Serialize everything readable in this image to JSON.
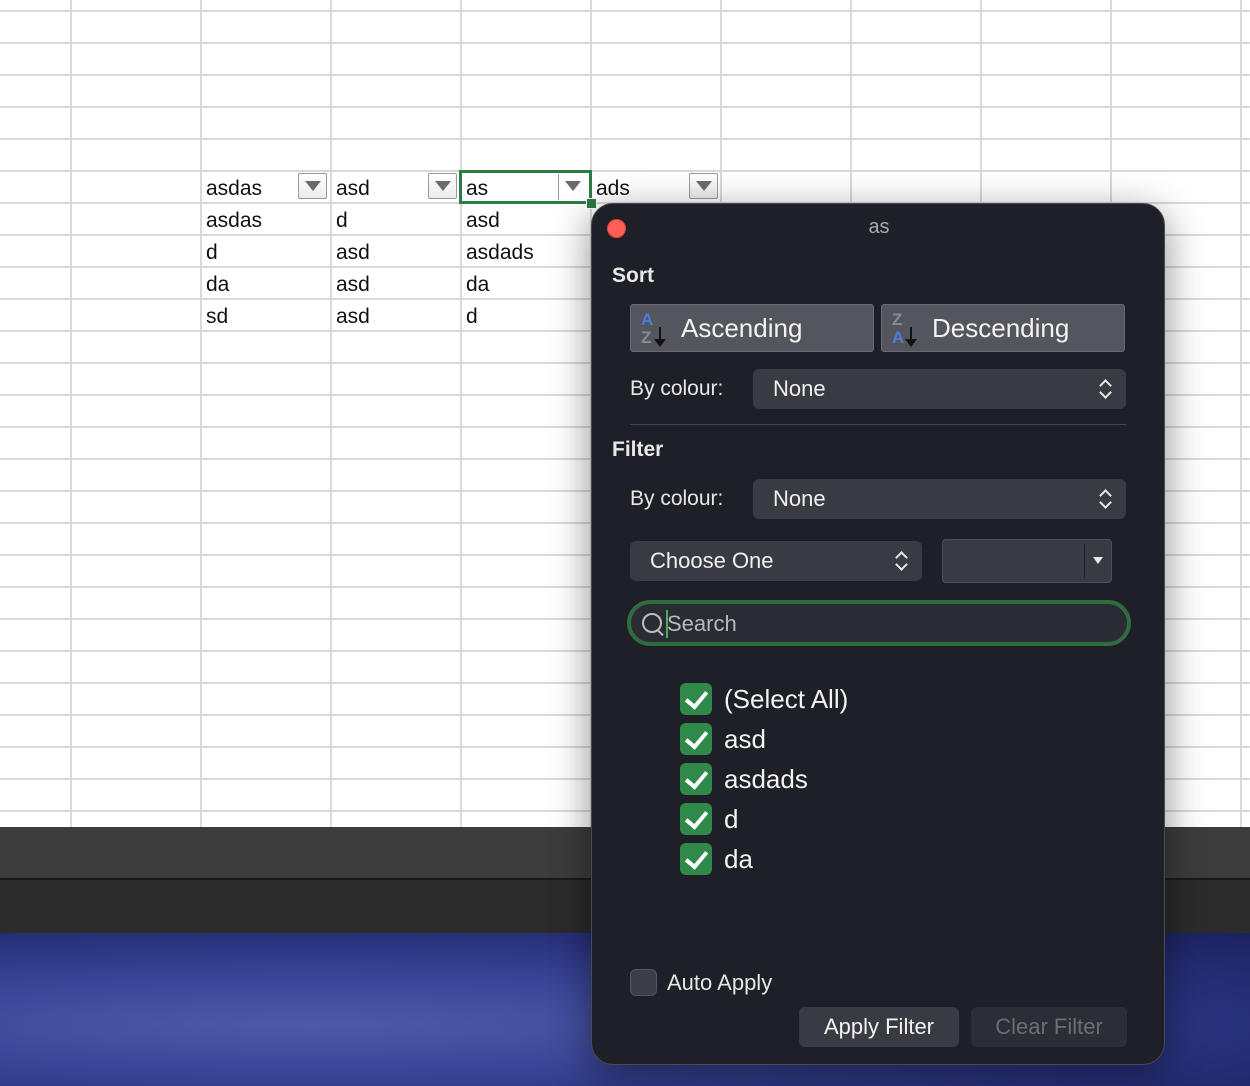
{
  "sheet": {
    "headers": [
      "asdas",
      "asd",
      "as",
      "ads"
    ],
    "rows": [
      [
        "asdas",
        "d",
        "asd"
      ],
      [
        "d",
        "asd",
        "asdads"
      ],
      [
        "da",
        "asd",
        "da"
      ],
      [
        "sd",
        "asd",
        "d"
      ]
    ]
  },
  "popup": {
    "title": "as",
    "sort": {
      "heading": "Sort",
      "ascending_label": "Ascending",
      "descending_label": "Descending",
      "by_colour_label": "By colour:",
      "by_colour_value": "None",
      "asc_icon": {
        "top": "A",
        "bottom": "Z"
      },
      "desc_icon": {
        "top": "Z",
        "bottom": "A"
      }
    },
    "filter": {
      "heading": "Filter",
      "by_colour_label": "By colour:",
      "by_colour_value": "None",
      "condition_value": "Choose One",
      "condition_text": "",
      "search_placeholder": "Search",
      "items": [
        {
          "label": "(Select All)",
          "checked": true
        },
        {
          "label": "asd",
          "checked": true
        },
        {
          "label": "asdads",
          "checked": true
        },
        {
          "label": "d",
          "checked": true
        },
        {
          "label": "da",
          "checked": true
        }
      ],
      "auto_apply_label": "Auto Apply",
      "auto_apply_checked": false,
      "apply_label": "Apply Filter",
      "clear_label": "Clear Filter"
    }
  },
  "colors": {
    "accent_green": "#2f8a49",
    "selection_green": "#2e7c45",
    "popup_bg": "#1f2027",
    "close_red": "#ff5f57"
  }
}
